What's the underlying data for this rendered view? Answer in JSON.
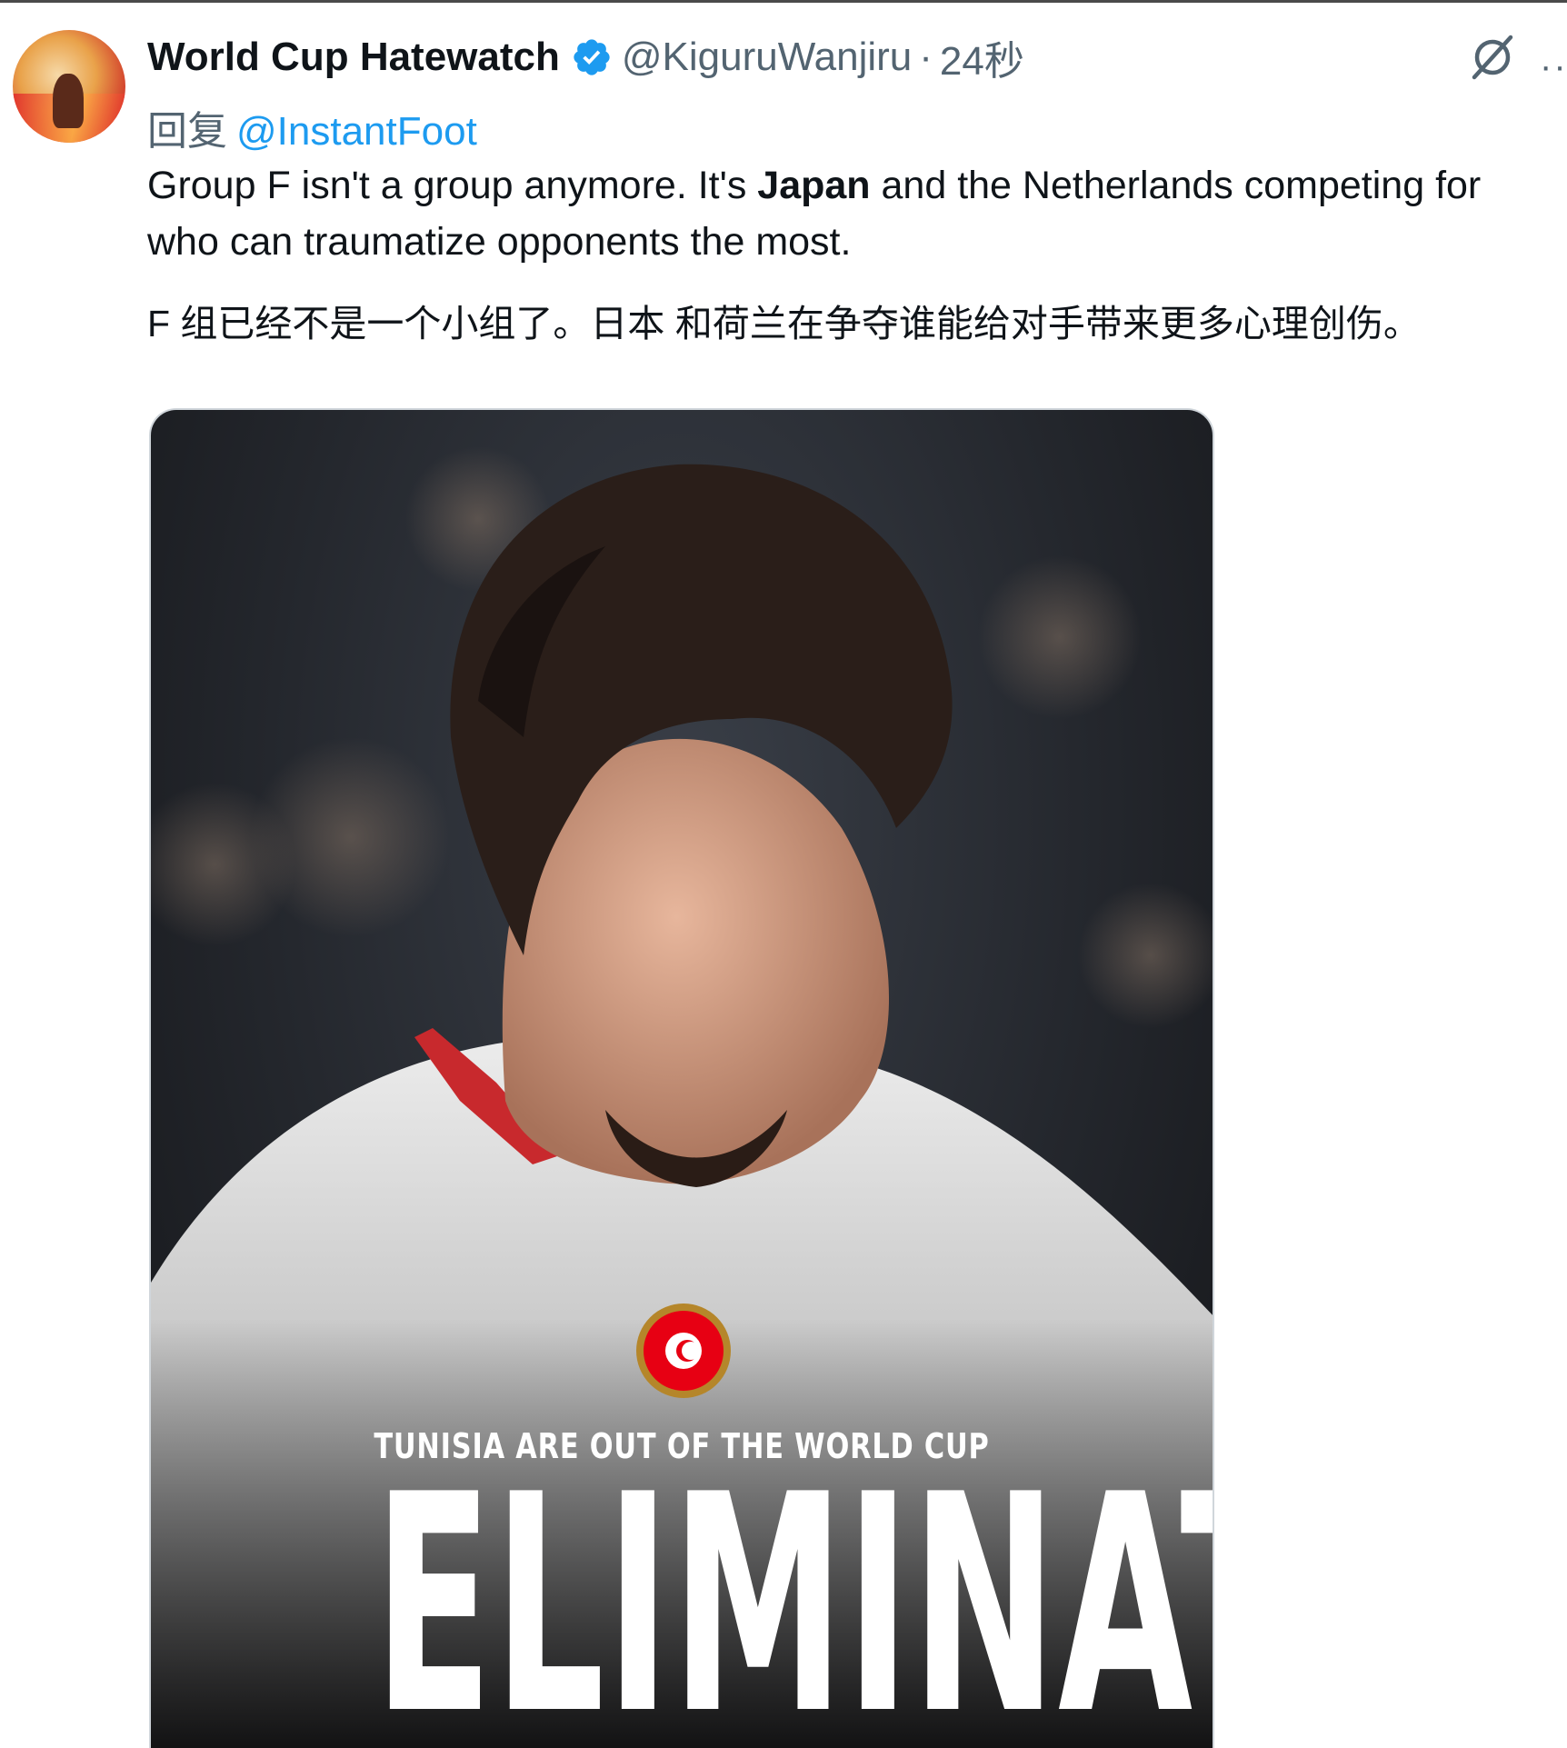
{
  "tweet": {
    "display_name": "World Cup Hatewatch",
    "handle": "@KiguruWanjiru",
    "separator": "·",
    "time": "24秒",
    "reply_label": "回复",
    "reply_to": "@InstantFoot",
    "text_part1": "Group F isn't a group anymore. It's ",
    "text_bold": "Japan",
    "text_part2": " and the Netherlands competing for who can traumatize opponents the most.",
    "translation": "F 组已经不是一个小组了。日本 和荷兰在争夺谁能给对手带来更多心理创伤。",
    "more_label": "··"
  },
  "media": {
    "headline": "TUNISIA ARE OUT OF THE WORLD CUP",
    "big_text": "ELIMINATED"
  },
  "icons": {
    "verified": "verified-badge-icon",
    "grok": "grok-icon",
    "more": "more-icon",
    "flag": "tunisia-flag-icon"
  },
  "colors": {
    "accent": "#1d9bf0",
    "secondary_text": "#536471",
    "tunisia_red": "#e70013"
  }
}
